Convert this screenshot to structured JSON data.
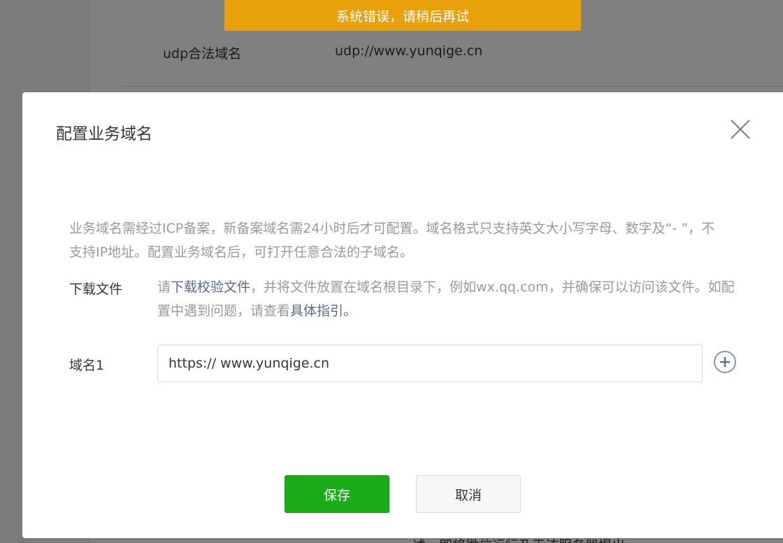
{
  "toast": {
    "message": "系统错误，请稍后再试"
  },
  "background": {
    "row_label": "udp合法域名",
    "row_value": "udp://www.yunqige.cn",
    "bottom_text": "述，即将微信运行及于该服务器提出"
  },
  "dialog": {
    "title": "配置业务域名",
    "tip": "业务域名需经过ICP备案，新备案域名需24小时后才可配置。域名格式只支持英文大小写字母、数字及“- ”，不支持IP地址。配置业务域名后，可打开任意合法的子域名。",
    "download": {
      "label": "下载文件",
      "prefix": "请",
      "link_text": "下载校验文件",
      "middle": "，并将文件放置在域名根目录下，例如wx.qq.com，并确保可以访问该文件。如配置中遇到问题，请查看",
      "guide_link": "具体指引",
      "suffix": "。"
    },
    "domain_field": {
      "label": "域名1",
      "value": "https:// www.yunqige.cn"
    },
    "buttons": {
      "save": "保存",
      "cancel": "取消"
    }
  },
  "colors": {
    "toast_bg": "#e8a00b",
    "save_bg": "#1aad19",
    "link": "#576b95",
    "icon_accent": "#8a96b4"
  },
  "icons": {
    "close": "close-icon",
    "add": "plus-circle-icon"
  }
}
